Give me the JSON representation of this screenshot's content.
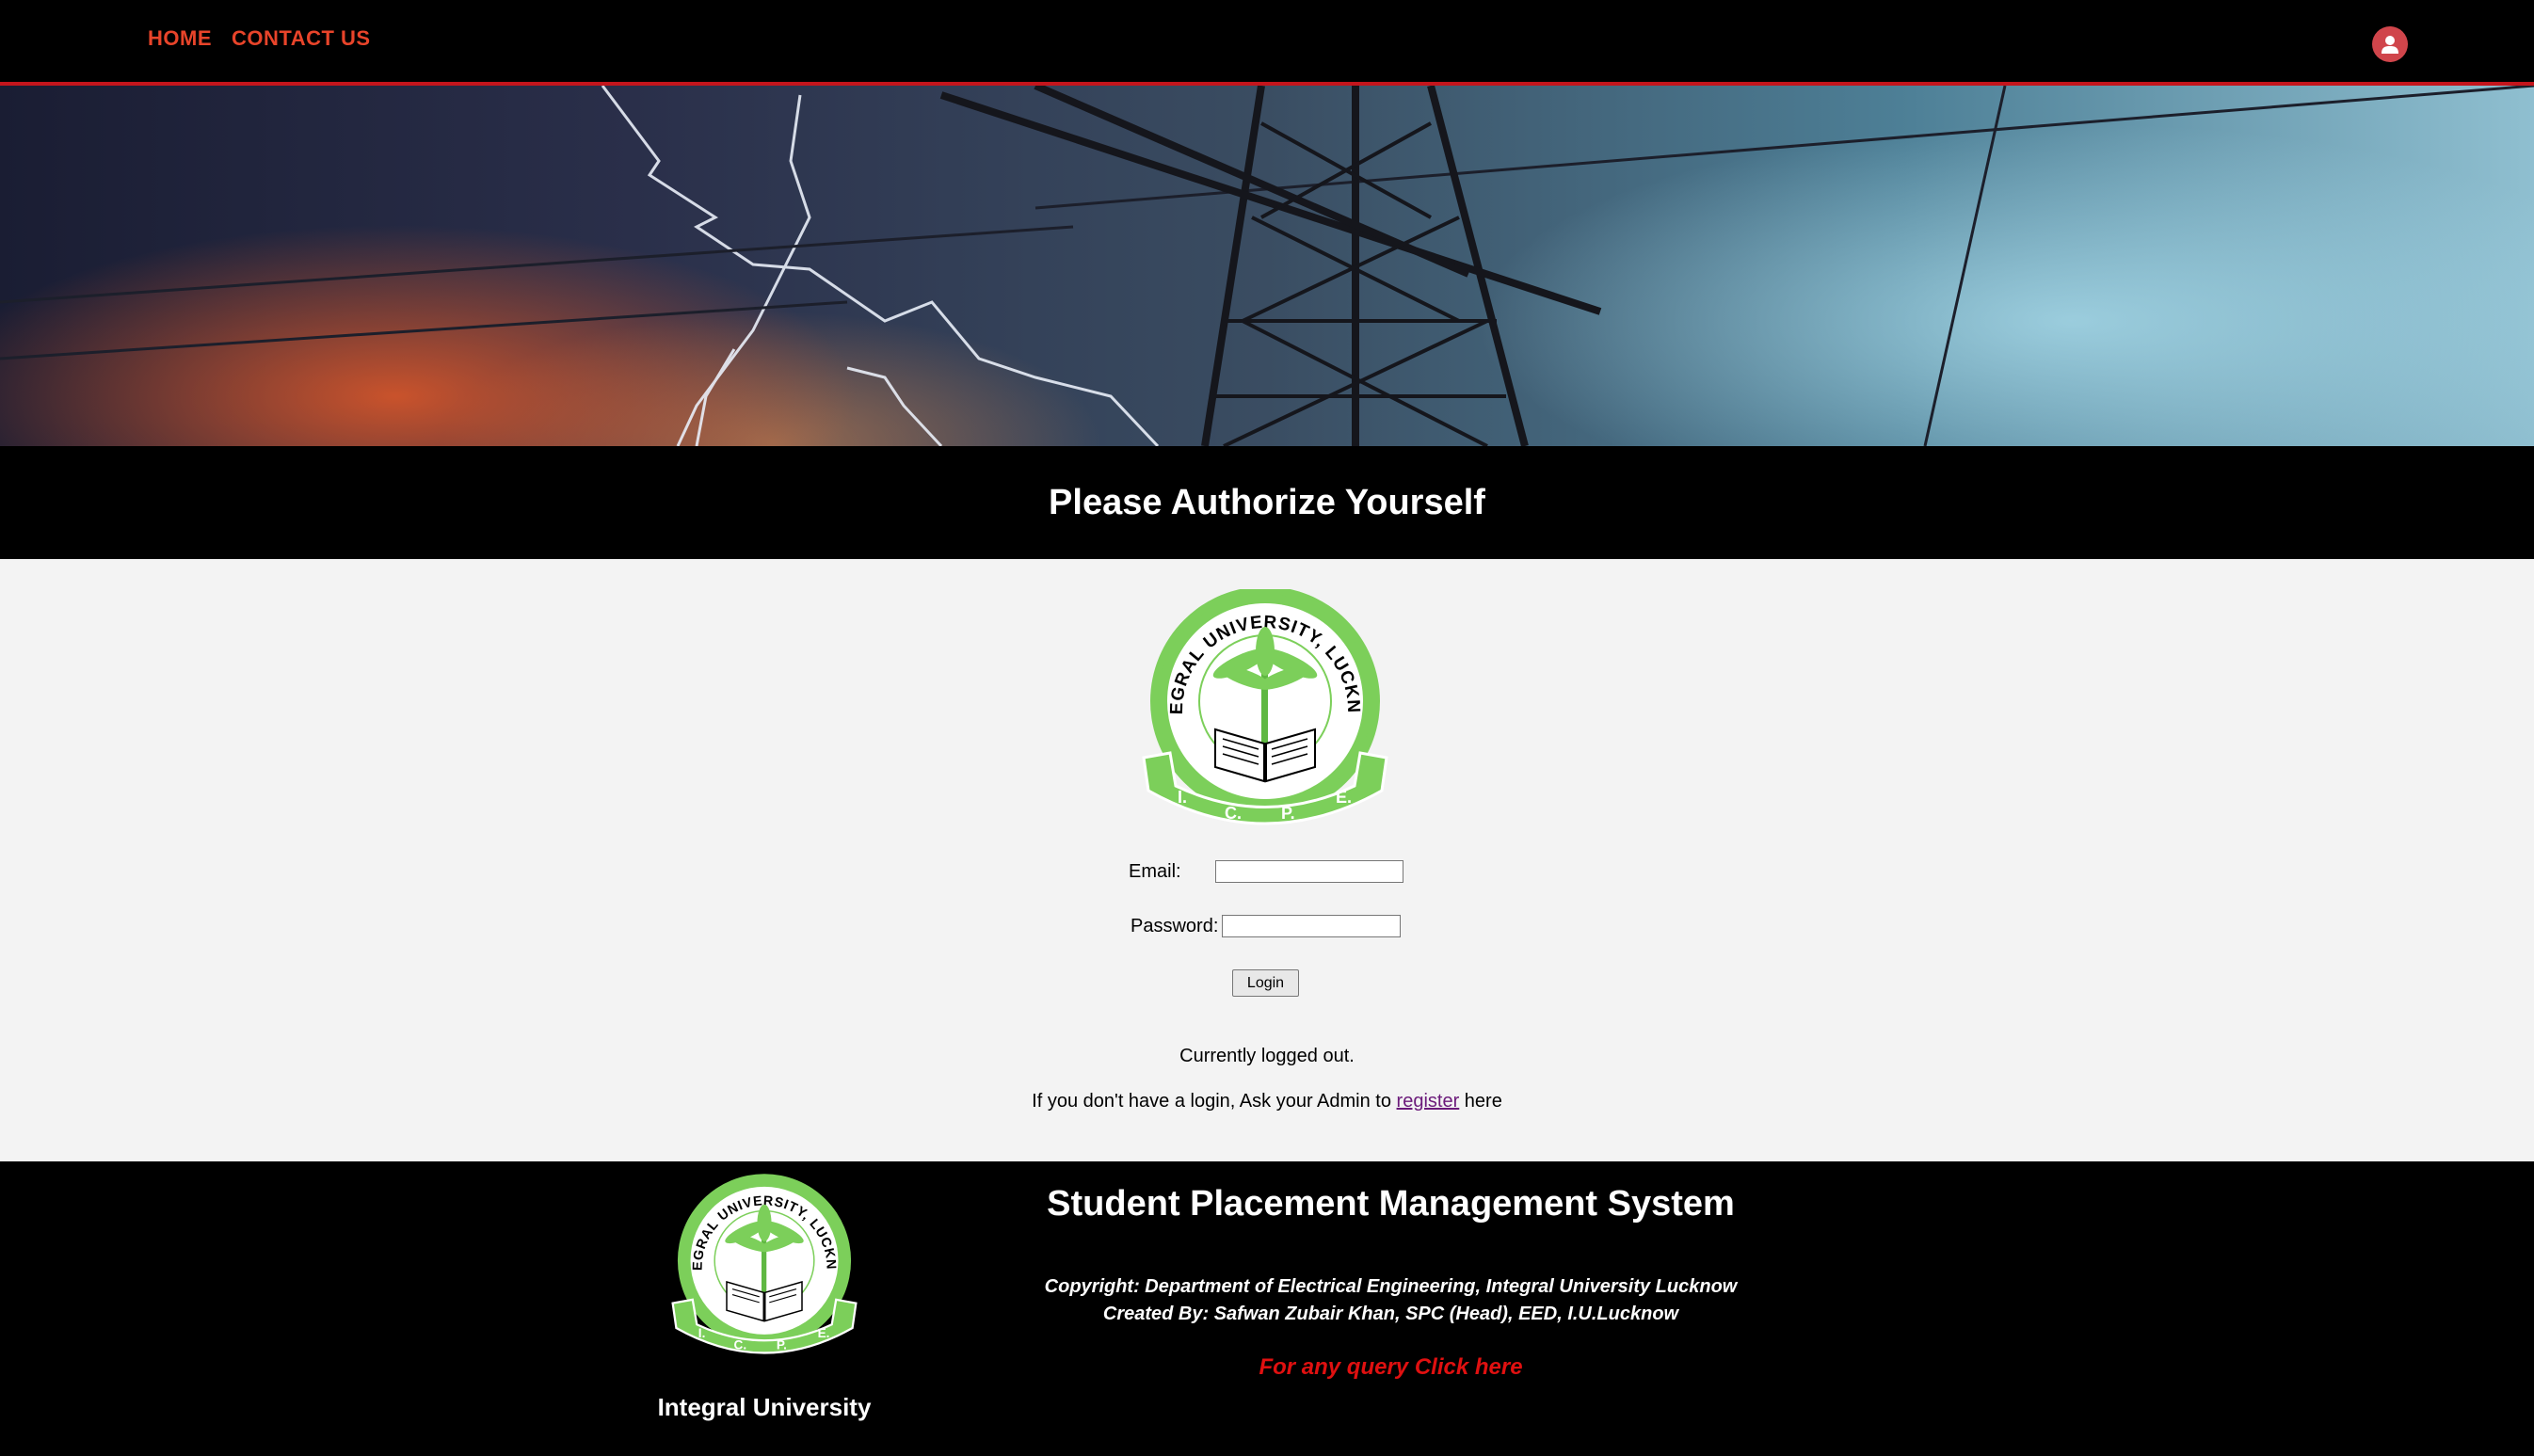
{
  "nav": {
    "home_label": "HOME",
    "contact_label": "CONTACT US"
  },
  "page": {
    "title": "Please Authorize Yourself"
  },
  "logo": {
    "ring_text": "INTEGRAL UNIVERSITY, LUCKNOW",
    "banner_letters": [
      "I.",
      "C.",
      "P.",
      "E."
    ]
  },
  "form": {
    "email_label": "Email:",
    "email_value": "",
    "password_label": "Password:",
    "password_value": "",
    "login_label": "Login"
  },
  "status": {
    "logged_out_text": "Currently logged out.",
    "register_prefix": "If you don't have a login, Ask your Admin to ",
    "register_link": "register",
    "register_suffix": " here"
  },
  "footer": {
    "university": "Integral University",
    "system_title": "Student Placement Management System",
    "copyright": "Copyright: Department of Electrical Engineering, Integral University Lucknow",
    "created_by": "Created By: Safwan Zubair Khan, SPC (Head), EED, I.U.Lucknow",
    "query_link": "For any query Click here"
  },
  "colors": {
    "accent_red": "#c4151c",
    "nav_link": "#e8442a",
    "logo_green": "#7ccf5a",
    "query_red": "#e01010"
  }
}
